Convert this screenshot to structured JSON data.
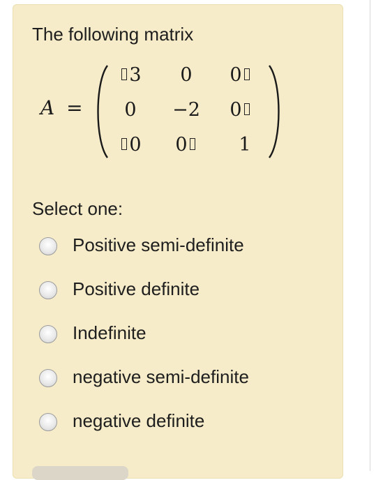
{
  "question": {
    "intro": "The following matrix"
  },
  "matrix": {
    "variable": "A",
    "equals": "=",
    "rows": [
      [
        "3",
        "0",
        "0"
      ],
      [
        "0",
        "−2",
        "0"
      ],
      [
        "0",
        "0",
        "1"
      ]
    ]
  },
  "select_label": "Select one:",
  "options": [
    {
      "label": "Positive semi-definite",
      "selected": false
    },
    {
      "label": "Positive definite",
      "selected": false
    },
    {
      "label": "Indefinite",
      "selected": false
    },
    {
      "label": "negative semi-definite",
      "selected": false
    },
    {
      "label": "negative definite",
      "selected": false
    }
  ],
  "colors": {
    "card_background": "#f6ecc9",
    "text": "#1e1e1e"
  }
}
